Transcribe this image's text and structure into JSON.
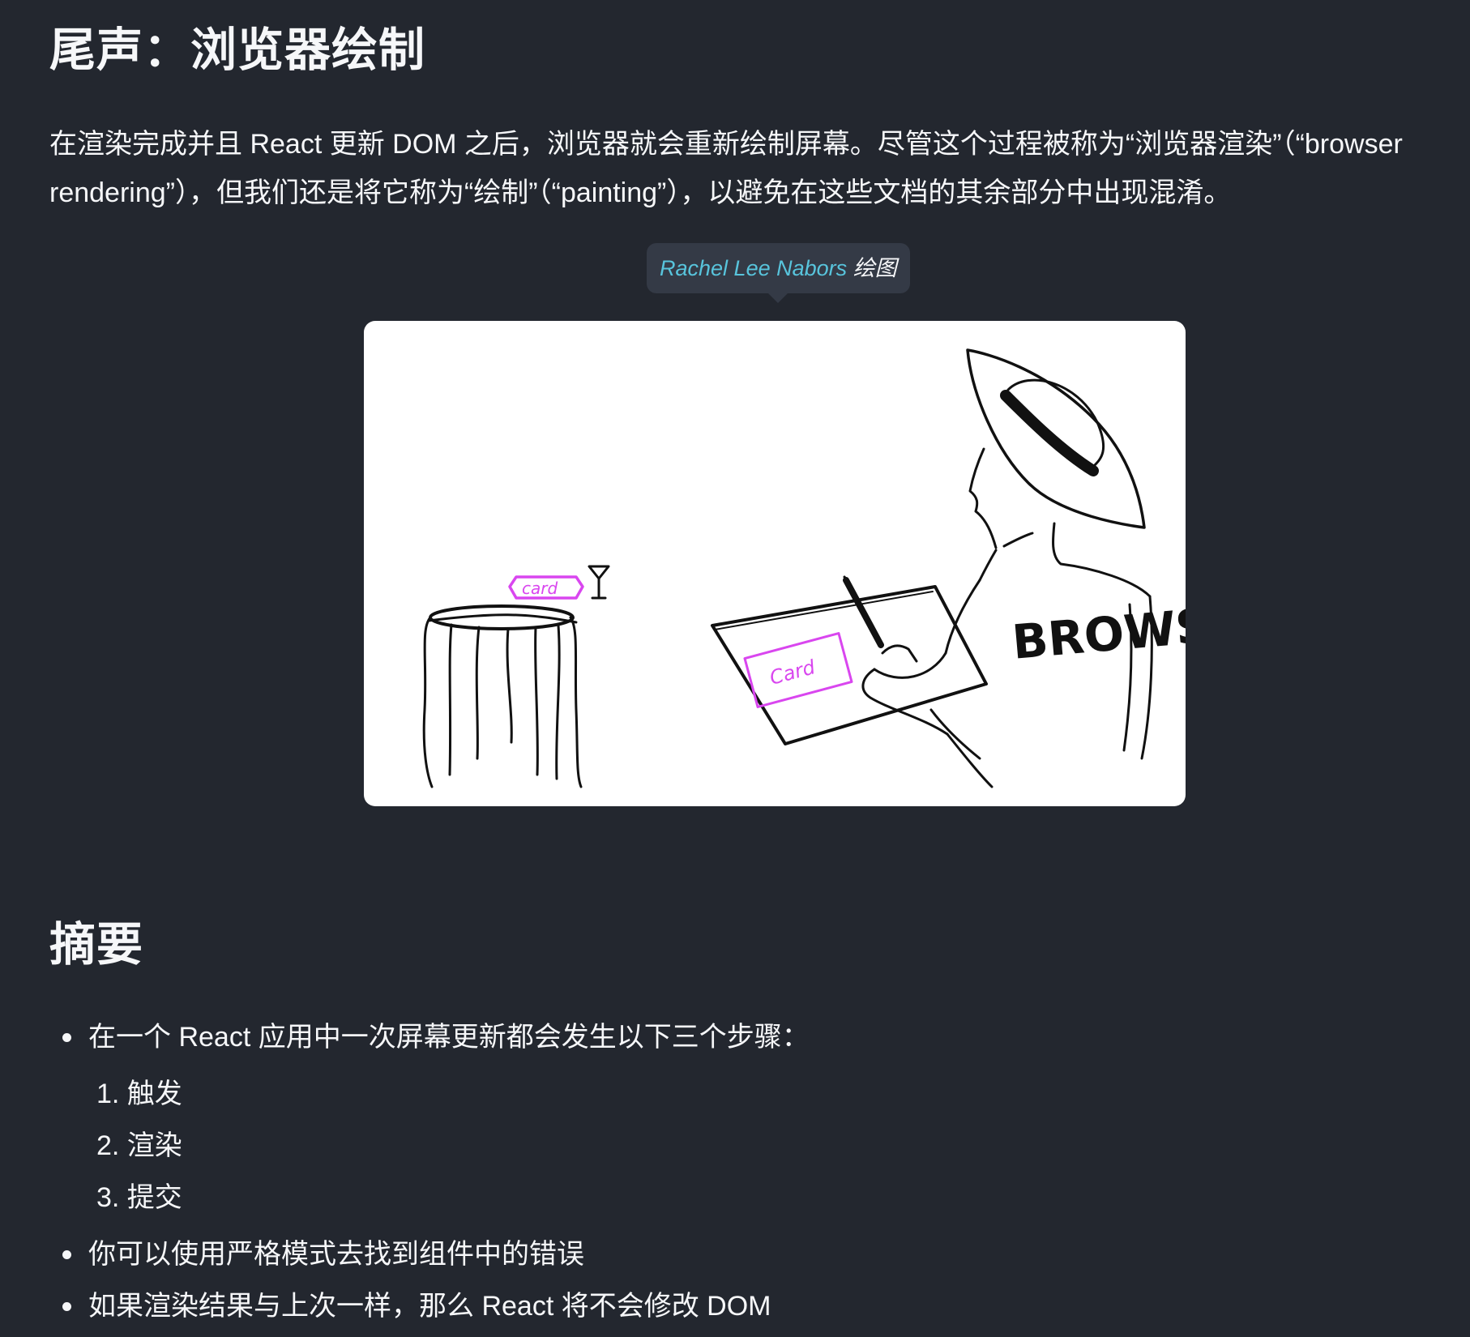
{
  "epilogue": {
    "title": "尾声：浏览器绘制",
    "paragraph": "在渲染完成并且 React 更新 DOM 之后，浏览器就会重新绘制屏幕。尽管这个过程被称为“浏览器渲染”（“browser rendering”），但我们还是将它称为“绘制”（“painting”），以避免在这些文档的其余部分中出现混淆。"
  },
  "illustration": {
    "credit_author": "Rachel Lee Nabors",
    "credit_suffix": " 绘图",
    "shirt_text": "BROWSER",
    "table_card_text": "card",
    "canvas_card_text": "Card"
  },
  "summary": {
    "title": "摘要",
    "items": [
      {
        "text": "在一个 React 应用中一次屏幕更新都会发生以下三个步骤：",
        "steps": [
          "1. 触发",
          "2. 渲染",
          "3. 提交"
        ]
      },
      {
        "text": "你可以使用严格模式去找到组件中的错误"
      },
      {
        "text": "如果渲染结果与上次一样，那么 React 将不会修改 DOM"
      }
    ]
  },
  "colors": {
    "background": "#23272f",
    "text": "#f6f7f9",
    "link": "#58c4dc",
    "tooltip_bg": "#343a46",
    "card_magenta": "#d946ef"
  }
}
